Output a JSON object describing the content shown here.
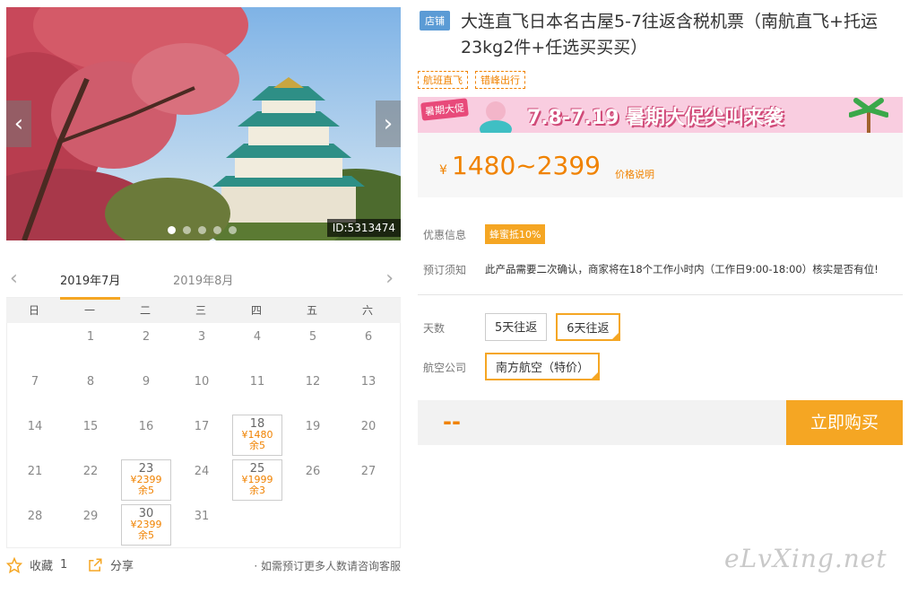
{
  "gallery": {
    "image_id": "ID:5313474",
    "prev_icon": "‹",
    "next_icon": "›",
    "slide_count": 5
  },
  "calendar": {
    "months": [
      "2019年7月",
      "2019年8月"
    ],
    "active_month": 0,
    "prev_icon": "‹",
    "next_icon": "›",
    "weekdays": [
      "日",
      "一",
      "二",
      "三",
      "四",
      "五",
      "六"
    ],
    "start_offset": 1,
    "days": [
      {
        "d": "1"
      },
      {
        "d": "2"
      },
      {
        "d": "3"
      },
      {
        "d": "4"
      },
      {
        "d": "5"
      },
      {
        "d": "6"
      },
      {
        "d": "7"
      },
      {
        "d": "8"
      },
      {
        "d": "9"
      },
      {
        "d": "10"
      },
      {
        "d": "11"
      },
      {
        "d": "12"
      },
      {
        "d": "13"
      },
      {
        "d": "14"
      },
      {
        "d": "15"
      },
      {
        "d": "16"
      },
      {
        "d": "17"
      },
      {
        "d": "18",
        "price": "¥1480",
        "left": "余5"
      },
      {
        "d": "19"
      },
      {
        "d": "20"
      },
      {
        "d": "21"
      },
      {
        "d": "22"
      },
      {
        "d": "23",
        "price": "¥2399",
        "left": "余5"
      },
      {
        "d": "24"
      },
      {
        "d": "25",
        "price": "¥1999",
        "left": "余3"
      },
      {
        "d": "26"
      },
      {
        "d": "27"
      },
      {
        "d": "28"
      },
      {
        "d": "29"
      },
      {
        "d": "30",
        "price": "¥2399",
        "left": "余5"
      },
      {
        "d": "31"
      }
    ]
  },
  "footer": {
    "favorite_label": "收藏",
    "favorite_count": "1",
    "share_label": "分享",
    "note": "· 如需预订更多人数请咨询客服"
  },
  "product": {
    "shop_badge": "店铺",
    "title": "大连直飞日本名古屋5-7往返含税机票（南航直飞+托运23kg2件+任选买买买）",
    "tags": [
      "航班直飞",
      "错峰出行"
    ]
  },
  "promo": {
    "badge": "暑期大促",
    "text": "7.8-7.19 暑期大促尖叫来袭"
  },
  "price": {
    "currency": "¥",
    "range": "1480~2399",
    "note": "价格说明"
  },
  "info": {
    "discount_label": "优惠信息",
    "discount_badge": "蜂蜜抵10%",
    "booking_label": "预订须知",
    "booking_text": "此产品需要二次确认，商家将在18个工作小时内（工作日9:00-18:00）核实是否有位!"
  },
  "options": {
    "days_label": "天数",
    "days": [
      "5天往返",
      "6天往返"
    ],
    "days_selected": 1,
    "airline_label": "航空公司",
    "airlines": [
      "南方航空（特价）"
    ],
    "airline_selected": 0
  },
  "buy": {
    "total": "--",
    "button": "立即购买"
  },
  "watermark": "eLvXing.net",
  "colors": {
    "accent": "#f5a623",
    "price": "#f08200",
    "badge_blue": "#5b9bd5"
  }
}
